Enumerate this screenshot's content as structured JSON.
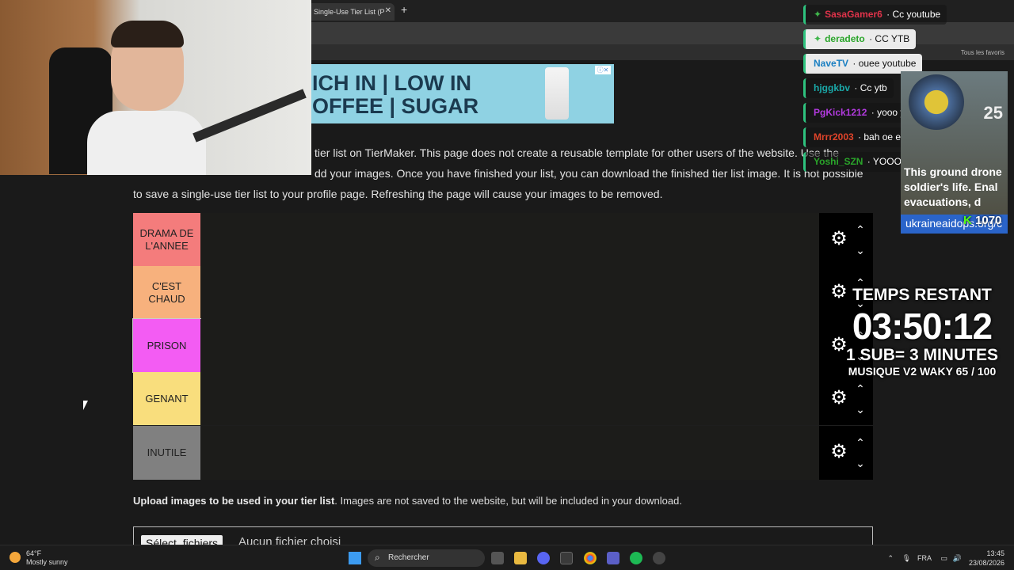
{
  "browser": {
    "tab_title": "Single-Use Tier List (P",
    "bookmark_label": "Tous les favoris"
  },
  "ad": {
    "headline": "ICH IN | LOW IN\nOFFEE | SUGAR"
  },
  "page": {
    "intro_part1": "tier list on TierMaker. This page does not create a reusable template for other users of the website. Use the",
    "intro_part2": "dd your images. Once you have finished your list, you can download the finished tier list image. It is not possible",
    "intro_part3": "to save a single-use tier list to your profile page. Refreshing the page will cause your images to be removed.",
    "upload_bold": "Upload images to be used in your tier list",
    "upload_rest": ". Images are not saved to the website, but will be included in your download.",
    "file_button": "Sélect. fichiers",
    "file_none": "Aucun fichier choisi"
  },
  "tiers": [
    {
      "label": "DRAMA DE L'ANNEE",
      "color": "#f47c7c"
    },
    {
      "label": "C'EST CHAUD",
      "color": "#f7b17d"
    },
    {
      "label": "PRISON",
      "color": "#f35cf3"
    },
    {
      "label": "GENANT",
      "color": "#f9de7d"
    },
    {
      "label": "INUTILE",
      "color": "#808080"
    }
  ],
  "chat": [
    {
      "name": "SasaGamer6",
      "msg": "Cc youtube",
      "color": "#e0334a",
      "star": true,
      "dark": true
    },
    {
      "name": "deradeto",
      "msg": "CC YTB",
      "color": "#2aa52a",
      "star": true,
      "dark": false
    },
    {
      "name": "NaveTV",
      "msg": "ouee youtube",
      "color": "#1a7fc2",
      "star": false,
      "dark": false
    },
    {
      "name": "hjggkbv",
      "msg": "Cc ytb",
      "color": "#1aa9a9",
      "star": false,
      "dark": true
    },
    {
      "name": "PgKick1212",
      "msg": "yooo yo yo",
      "color": "#b33ae0",
      "star": false,
      "dark": true
    },
    {
      "name": "Mrrr2003",
      "msg": "bah oe els pire drama bg",
      "color": "#e0442a",
      "star": false,
      "dark": true
    },
    {
      "name": "Yoshi_SZN",
      "msg": "YOOO",
      "color": "#2aa52a",
      "star": false,
      "dark": true
    }
  ],
  "news": {
    "number": "25",
    "text": "This ground drone\nsoldier's life. Enal\nevacuations, d",
    "url": "ukraineaidops.org/c",
    "count": "1070"
  },
  "timer": {
    "line1": "TEMPS RESTANT",
    "line2": "03:50:12",
    "line3": "1 SUB= 3 MINUTES",
    "line4": "MUSIQUE V2 WAKY 65 / 100"
  },
  "taskbar": {
    "temp": "64°F",
    "weather": "Mostly sunny",
    "search": "Rechercher",
    "lang": "FRA",
    "time": "13:45",
    "date": "23/08/2026"
  }
}
